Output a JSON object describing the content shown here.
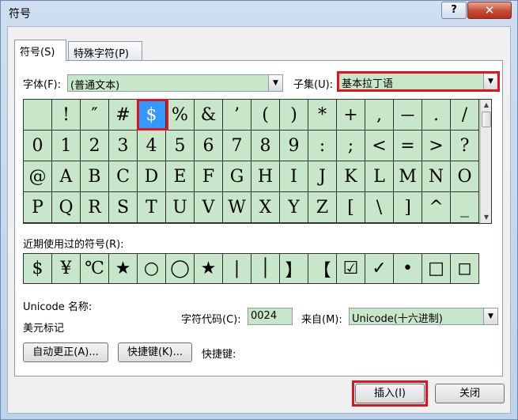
{
  "window": {
    "title": "符号",
    "help_label": "?",
    "close_label": "✕"
  },
  "tabs": [
    {
      "label": "符号(S)"
    },
    {
      "label": "特殊字符(P)"
    }
  ],
  "font": {
    "label": "字体(F):",
    "value": "(普通文本)"
  },
  "subset": {
    "label": "子集(U):",
    "value": "基本拉丁语"
  },
  "symbols": [
    " ",
    "!",
    "″",
    "#",
    "$",
    "%",
    "&",
    "’",
    "(",
    ")",
    "*",
    "+",
    ",",
    "－",
    ".",
    "/",
    "0",
    "1",
    "2",
    "3",
    "4",
    "5",
    "6",
    "7",
    "8",
    "9",
    ":",
    ";",
    "<",
    "=",
    ">",
    "?",
    "@",
    "A",
    "B",
    "C",
    "D",
    "E",
    "F",
    "G",
    "H",
    "I",
    "J",
    "K",
    "L",
    "M",
    "N",
    "O",
    "P",
    "Q",
    "R",
    "S",
    "T",
    "U",
    "V",
    "W",
    "X",
    "Y",
    "Z",
    "[",
    "\\",
    "]",
    "^",
    "_"
  ],
  "selected_symbol": "$",
  "recent": {
    "label": "近期使用过的符号(R):",
    "items": [
      "$",
      "¥",
      "℃",
      "★",
      "○",
      "◯",
      "★",
      "|",
      "│",
      "】",
      "【",
      "☑",
      "✓",
      "•",
      "□",
      "◻"
    ]
  },
  "unicode_name": {
    "label": "Unicode 名称:",
    "value": "美元标记"
  },
  "char_code": {
    "label": "字符代码(C):",
    "value": "0024"
  },
  "from": {
    "label": "来自(M):",
    "value": "Unicode(十六进制)"
  },
  "buttons": {
    "autocorrect": "自动更正(A)...",
    "shortcut_key": "快捷键(K)...",
    "shortcut_label": "快捷键:",
    "insert": "插入(I)",
    "close": "关闭"
  },
  "colors": {
    "highlight": "#e0141e",
    "selection": "#3399ff",
    "cell_background": "#c8e6c9"
  },
  "icons": {
    "dropdown": "chevron-down-icon",
    "scroll_up": "scroll-up-icon",
    "scroll_down": "scroll-down-icon"
  }
}
